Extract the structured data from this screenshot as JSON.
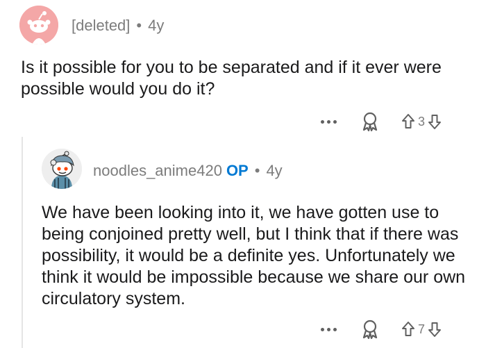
{
  "comment": {
    "author": "[deleted]",
    "separator": "•",
    "age": "4y",
    "body": "Is it possible for you to be separated and if it ever were possible would you do it?",
    "vote_count": "3"
  },
  "reply": {
    "author": "noodles_anime420",
    "op_badge": "OP",
    "separator": "•",
    "age": "4y",
    "body": "We have been looking into it, we have gotten use to being conjoined pretty well, but I think that if there was possibility, it would be a definite yes. Unfortunately we think it would be impossible because we share our own circulatory system.",
    "vote_count": "7"
  },
  "colors": {
    "meta_gray": "#7c7c7c",
    "op_blue": "#0079d3",
    "avatar_pink": "#f4a7a7",
    "thread_line": "#e5e5e5"
  },
  "icons": [
    "snoo-avatar-icon",
    "more-options-icon",
    "award-icon",
    "upvote-icon",
    "downvote-icon"
  ]
}
